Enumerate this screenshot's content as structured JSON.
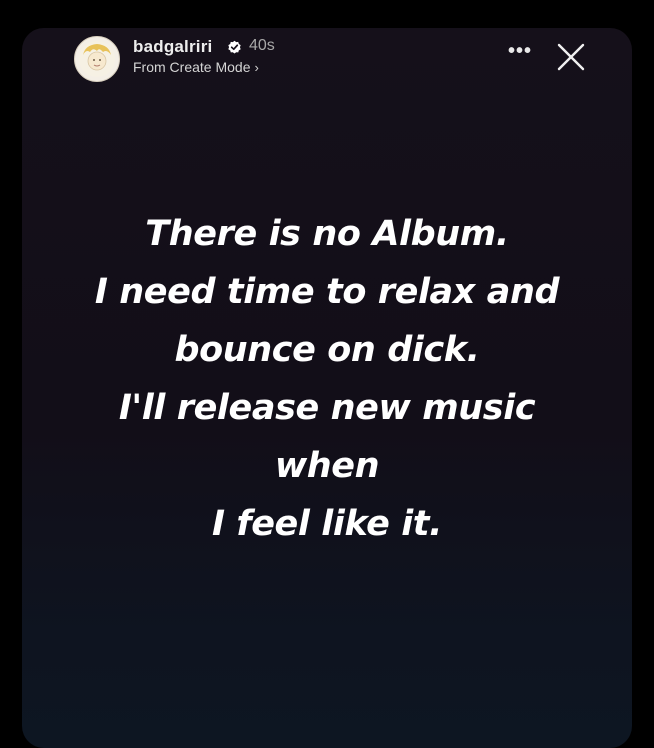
{
  "header": {
    "username": "badgalriri",
    "time_ago": "40s",
    "subtitle": "From Create Mode",
    "subtitle_chevron": "›",
    "more_label": "•••"
  },
  "story": {
    "lines": [
      "There is no Album.",
      "I need time to relax and",
      "bounce on dick.",
      "I'll release new music",
      "when",
      "I feel like it."
    ]
  },
  "colors": {
    "background": "#000000",
    "story_background": "#15101a",
    "text": "#ffffff",
    "verified": "#ffffff"
  },
  "icons": {
    "avatar": "avatar-icon",
    "verified": "verified-badge-icon",
    "more": "more-options-icon",
    "close": "close-icon"
  }
}
